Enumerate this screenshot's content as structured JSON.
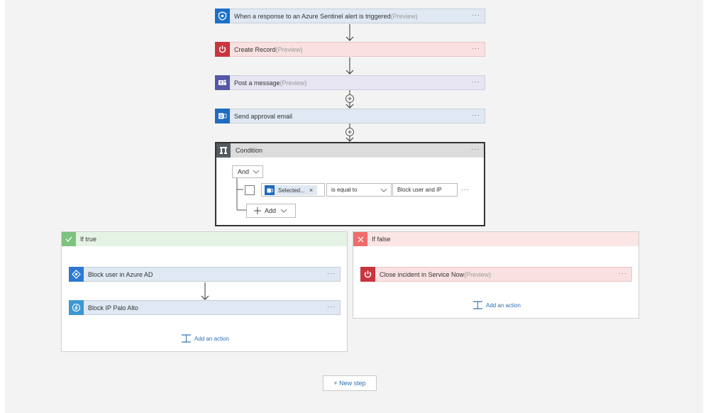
{
  "flow": {
    "trigger": {
      "label": "When a response to an Azure Sentinel alert is triggered",
      "suffix": "(Preview)",
      "menu": "···"
    },
    "create_record": {
      "label": "Create Record",
      "suffix": "(Preview)",
      "menu": "···"
    },
    "post_message": {
      "label": "Post a message",
      "suffix": "(Preview)",
      "menu": "···"
    },
    "send_email": {
      "label": "Send approval email",
      "menu": "···"
    }
  },
  "condition": {
    "title": "Condition",
    "menu": "···",
    "group": "And",
    "token": "Selected...",
    "token_remove": "×",
    "operator": "is equal to",
    "value": "Block user and IP",
    "row_menu": "···",
    "add": "Add"
  },
  "if_true": {
    "title": "If true",
    "actions": [
      {
        "label": "Block user in Azure AD",
        "menu": "···"
      },
      {
        "label": "Block IP Palo Alto",
        "menu": "···"
      }
    ],
    "add_action": "Add an action"
  },
  "if_false": {
    "title": "If false",
    "actions": [
      {
        "label": "Close incident in Service Now",
        "suffix": "(Preview)",
        "menu": "···"
      }
    ],
    "add_action": "Add an action"
  },
  "new_step": "+ New step",
  "colors": {
    "sentinel": "#1b6fc9",
    "servicenow": "#c8353d",
    "teams": "#5458a7",
    "outlook": "#1f6bbf",
    "azuread": "#2b79d0",
    "logicapp": "#3d97d3",
    "condition": "#555b61",
    "true": "#7cc47c",
    "false": "#ef6b6b",
    "link": "#2d6fb4"
  }
}
